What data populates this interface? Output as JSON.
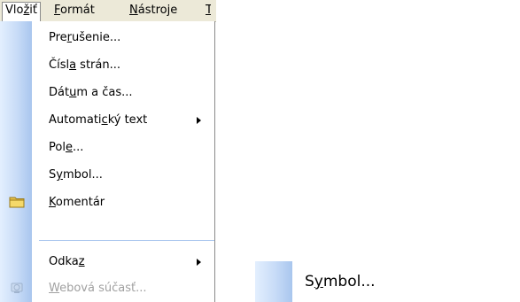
{
  "menubar": {
    "items": [
      {
        "pre": "Vlo",
        "mn": "ž",
        "post": "iť"
      },
      {
        "pre": "",
        "mn": "F",
        "post": "ormát"
      },
      {
        "pre": "",
        "mn": "N",
        "post": "ástroje"
      },
      {
        "pre": "",
        "mn": "T",
        "post": ""
      }
    ]
  },
  "menu": {
    "items": [
      {
        "pre": "Pre",
        "mn": "r",
        "post": "ušenie..."
      },
      {
        "pre": "Čísl",
        "mn": "a",
        "post": " strán..."
      },
      {
        "pre": "Dát",
        "mn": "u",
        "post": "m a čas..."
      },
      {
        "pre": "Automati",
        "mn": "c",
        "post": "ký text"
      },
      {
        "pre": "Pol",
        "mn": "e",
        "post": "..."
      },
      {
        "pre": "S",
        "mn": "y",
        "post": "mbol..."
      },
      {
        "pre": "",
        "mn": "K",
        "post": "omentár"
      },
      {
        "pre": "Odka",
        "mn": "z",
        "post": ""
      },
      {
        "pre": "",
        "mn": "W",
        "post": "ebová súčasť..."
      }
    ]
  },
  "zoom": {
    "pre": "S",
    "mn": "y",
    "post": "mbol..."
  }
}
